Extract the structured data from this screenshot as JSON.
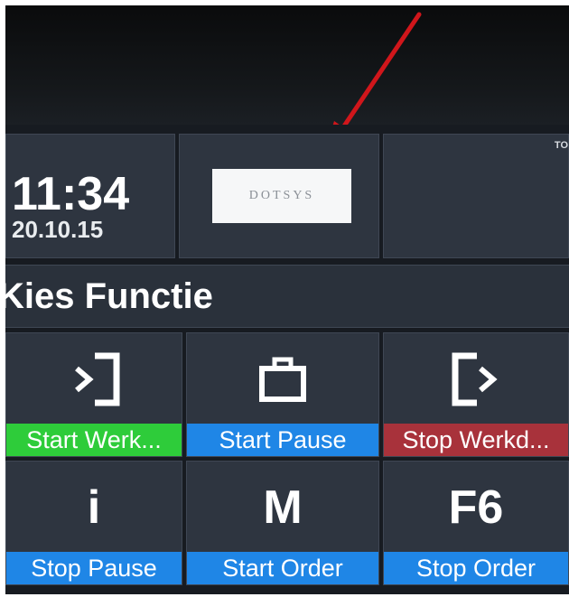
{
  "clock": {
    "time": "11:34",
    "date": "20.10.15"
  },
  "logo": {
    "text": "DOTSYS"
  },
  "corner_mark": "TO",
  "header": {
    "title": "Kies Functie"
  },
  "buttons": [
    {
      "label": "Start Werk...",
      "icon": "enter-icon",
      "color": "#2ecc3a"
    },
    {
      "label": "Start Pause",
      "icon": "briefcase-icon",
      "color": "#1f86e6"
    },
    {
      "label": "Stop Werkd...",
      "icon": "exit-icon",
      "color": "#a8323b"
    },
    {
      "label": "Stop Pause",
      "icon": "i",
      "color": "#1f86e6"
    },
    {
      "label": "Start Order",
      "icon": "M",
      "color": "#1f86e6"
    },
    {
      "label": "Stop Order",
      "icon": "F6",
      "color": "#1f86e6"
    }
  ],
  "annotation": {
    "arrow_color": "#d0161b"
  }
}
